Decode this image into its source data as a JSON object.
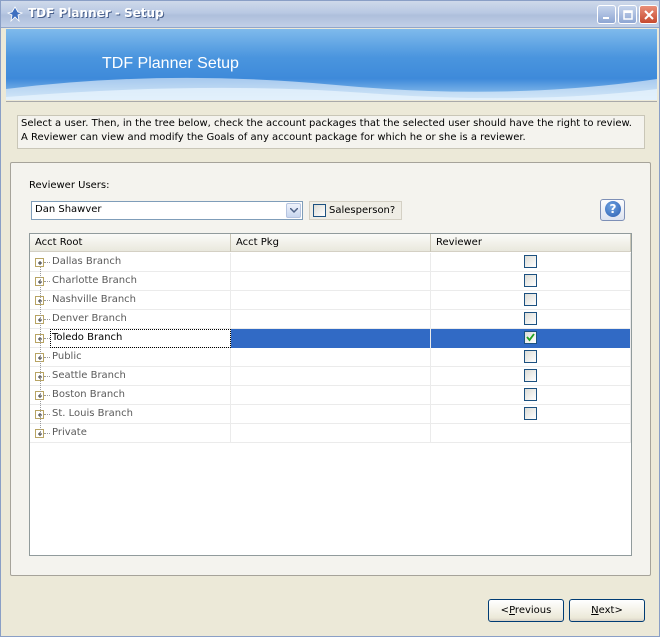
{
  "window": {
    "title": "TDF Planner - Setup"
  },
  "banner": {
    "title": "TDF Planner Setup"
  },
  "instructions": "Select a user.  Then, in the tree below, check the account packages that the selected user should have the right to review.  A Reviewer can view and modify the Goals of any account package for which he or she is a reviewer.",
  "reviewer": {
    "label": "Reviewer Users:",
    "selected_user": "Dan Shawver",
    "salesperson_label": "Salesperson?",
    "salesperson_checked": false
  },
  "grid": {
    "columns": [
      "Acct Root",
      "Acct Pkg",
      "Reviewer"
    ],
    "rows": [
      {
        "name": "Dallas Branch",
        "reviewer": false,
        "has_checkbox": true
      },
      {
        "name": "Charlotte Branch",
        "reviewer": false,
        "has_checkbox": true
      },
      {
        "name": "Nashville Branch",
        "reviewer": false,
        "has_checkbox": true
      },
      {
        "name": "Denver Branch",
        "reviewer": false,
        "has_checkbox": true
      },
      {
        "name": "Toledo Branch",
        "reviewer": true,
        "has_checkbox": true,
        "selected": true
      },
      {
        "name": "Public",
        "reviewer": false,
        "has_checkbox": true
      },
      {
        "name": "Seattle Branch",
        "reviewer": false,
        "has_checkbox": true
      },
      {
        "name": "Boston Branch",
        "reviewer": false,
        "has_checkbox": true
      },
      {
        "name": "St. Louis Branch",
        "reviewer": false,
        "has_checkbox": true
      },
      {
        "name": "Private",
        "reviewer": false,
        "has_checkbox": false
      }
    ]
  },
  "buttons": {
    "previous_hotkey": "P",
    "previous_rest": "revious",
    "previous_prefix": "<",
    "next_hotkey": "N",
    "next_rest": "ext>"
  },
  "colors": {
    "selection": "#316ac5",
    "banner": "#4a95de"
  }
}
